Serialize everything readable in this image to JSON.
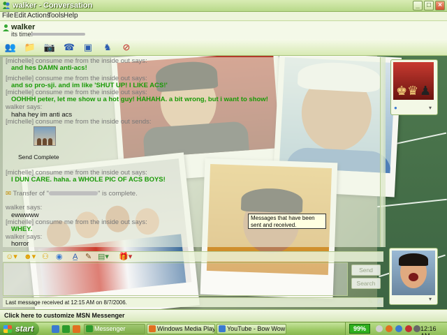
{
  "window": {
    "title": "walker - Conversation",
    "controls": {
      "minimize": "_",
      "maximize": "□",
      "close": "×"
    }
  },
  "menu": [
    "File",
    "Edit",
    "Actions",
    "Tools",
    "Help"
  ],
  "contact": {
    "name": "walker",
    "status": "its time!"
  },
  "toolbar_icons": [
    "invite-icon",
    "send-files-icon",
    "webcam-icon",
    "call-icon",
    "activities-icon",
    "games-icon",
    "block-icon"
  ],
  "history": [
    {
      "type": "says",
      "text": "[michelle] consume me from the inside out says:"
    },
    {
      "type": "msg-green",
      "text": "and hes DAMN anti-acs!"
    },
    {
      "type": "says",
      "text": "[michelle] consume me from the inside out says:"
    },
    {
      "type": "msg-green",
      "text": "and so pro-sji. and im like 'SHUT UP! I LIKE ACS!'"
    },
    {
      "type": "says",
      "text": "[michelle] consume me from the inside out says:"
    },
    {
      "type": "msg-green",
      "text": "OOHHH peter, let me show u a hot guy! HAHAHA. a bit wrong, but i want to show!"
    },
    {
      "type": "says",
      "text": "walker says:"
    },
    {
      "type": "msg-plain",
      "text": "haha hey im anti acs"
    },
    {
      "type": "says",
      "text": "[michelle] consume me from the inside out sends:"
    },
    {
      "type": "transfer",
      "text": "Send Complete"
    },
    {
      "type": "says",
      "text": "[michelle] consume me from the inside out says:"
    },
    {
      "type": "msg-green",
      "text": "I DUN CARE. haha. a WHOLE PIC OF ACS BOYS!"
    },
    {
      "type": "notice",
      "prefix": "Transfer of \"",
      "suffix": "\" is complete."
    },
    {
      "type": "says",
      "text": "walker says:"
    },
    {
      "type": "msg-plain",
      "text": "ewwwww"
    },
    {
      "type": "says",
      "text": "[michelle] consume me from the inside out says:"
    },
    {
      "type": "msg-green",
      "text": "WHEY."
    },
    {
      "type": "says",
      "text": "walker says:"
    },
    {
      "type": "msg-plain",
      "text": "horror"
    }
  ],
  "tooltip": "Messages that have been sent and received.",
  "compose": {
    "send_label": "Send",
    "search_label": "Search"
  },
  "status": "Last message received at 12:15 AM on 8/7/2006.",
  "ad": "Click here to customize MSN Messenger",
  "taskbar": {
    "start": "start",
    "tasks": [
      {
        "label": "Messenger",
        "active": true
      },
      {
        "label": "Windows Media Player",
        "active": false
      },
      {
        "label": "YouTube - Bow Wow ...",
        "active": false
      }
    ],
    "battery": "99%",
    "clock": "12:16 AM"
  },
  "colors": {
    "accent_green": "#199a06",
    "frame": "#eaf3d8",
    "taskbar": "#9cc865"
  }
}
